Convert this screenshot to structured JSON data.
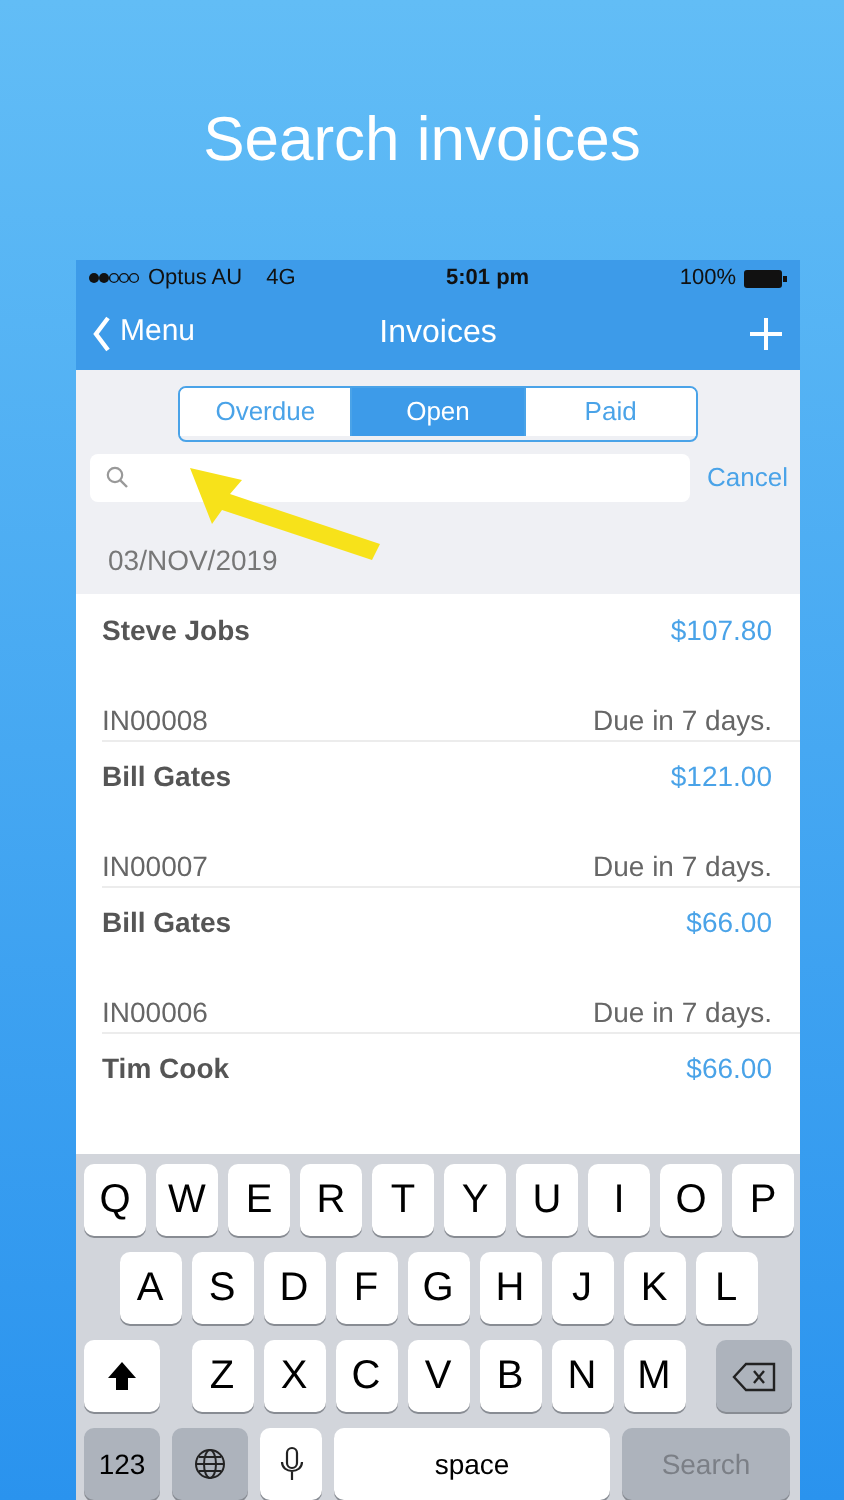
{
  "headline": "Search invoices",
  "status_bar": {
    "carrier": "Optus AU",
    "network": "4G",
    "time": "5:01 pm",
    "battery": "100%"
  },
  "nav": {
    "back": "Menu",
    "title": "Invoices"
  },
  "segments": [
    {
      "label": "Overdue",
      "selected": false
    },
    {
      "label": "Open",
      "selected": true
    },
    {
      "label": "Paid",
      "selected": false
    }
  ],
  "search": {
    "cancel": "Cancel"
  },
  "date_header": "03/NOV/2019",
  "invoices": [
    {
      "customer": "Steve Jobs",
      "amount": "$107.80",
      "number": "IN00008",
      "due": "Due in 7 days."
    },
    {
      "customer": "Bill Gates",
      "amount": "$121.00",
      "number": "IN00007",
      "due": "Due in 7 days."
    },
    {
      "customer": "Bill Gates",
      "amount": "$66.00",
      "number": "IN00006",
      "due": "Due in 7 days."
    },
    {
      "customer": "Tim Cook",
      "amount": "$66.00"
    }
  ],
  "keyboard": {
    "rows": [
      [
        {
          "kind": "letter",
          "label": "Q"
        },
        {
          "kind": "letter",
          "label": "W"
        },
        {
          "kind": "letter",
          "label": "E"
        },
        {
          "kind": "letter",
          "label": "R"
        },
        {
          "kind": "letter",
          "label": "T"
        },
        {
          "kind": "letter",
          "label": "Y"
        },
        {
          "kind": "letter",
          "label": "U"
        },
        {
          "kind": "letter",
          "label": "I"
        },
        {
          "kind": "letter",
          "label": "O"
        },
        {
          "kind": "letter",
          "label": "P"
        }
      ],
      [
        {
          "kind": "letter",
          "label": "A"
        },
        {
          "kind": "letter",
          "label": "S"
        },
        {
          "kind": "letter",
          "label": "D"
        },
        {
          "kind": "letter",
          "label": "F"
        },
        {
          "kind": "letter",
          "label": "G"
        },
        {
          "kind": "letter",
          "label": "H"
        },
        {
          "kind": "letter",
          "label": "J"
        },
        {
          "kind": "letter",
          "label": "K"
        },
        {
          "kind": "letter",
          "label": "L"
        }
      ],
      [
        {
          "kind": "shift"
        },
        {
          "kind": "letter",
          "label": "Z"
        },
        {
          "kind": "letter",
          "label": "X"
        },
        {
          "kind": "letter",
          "label": "C"
        },
        {
          "kind": "letter",
          "label": "V"
        },
        {
          "kind": "letter",
          "label": "B"
        },
        {
          "kind": "letter",
          "label": "N"
        },
        {
          "kind": "letter",
          "label": "M"
        },
        {
          "kind": "delete"
        }
      ]
    ],
    "bottom_row": [
      {
        "kind": "mode",
        "label": "123"
      },
      {
        "kind": "globe"
      },
      {
        "kind": "mic"
      },
      {
        "kind": "space",
        "label": "space"
      },
      {
        "kind": "action",
        "label": "Search"
      }
    ]
  }
}
